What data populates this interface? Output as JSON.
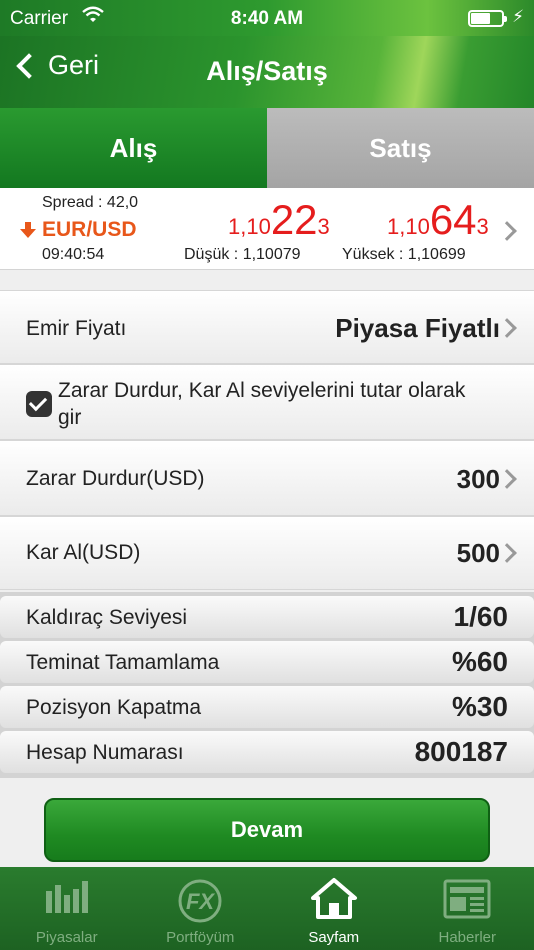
{
  "statusbar": {
    "carrier": "Carrier",
    "time": "8:40 AM"
  },
  "navbar": {
    "back_label": "Geri",
    "title": "Alış/Satış"
  },
  "segments": {
    "buy": "Alış",
    "sell": "Satış",
    "selected": "buy"
  },
  "quote": {
    "spread": "Spread : 42,0",
    "pair": "EUR/USD",
    "time": "09:40:54",
    "bid": {
      "prefix": "1,10",
      "big": "22",
      "suffix": "3"
    },
    "ask": {
      "prefix": "1,10",
      "big": "64",
      "suffix": "3"
    },
    "low": "Düşük :  1,10079",
    "high": "Yüksek : 1,10699"
  },
  "order": {
    "price_label": "Emir Fiyatı",
    "price_value": "Piyasa Fiyatlı",
    "checkbox_text": "Zarar Durdur, Kar Al seviyelerini tutar olarak gir",
    "checkbox_checked": true,
    "stop_label": "Zarar Durdur(USD)",
    "stop_value": "300",
    "take_label": "Kar Al(USD)",
    "take_value": "500"
  },
  "info": [
    {
      "label": "Kaldıraç Seviyesi",
      "value": "1/60"
    },
    {
      "label": "Teminat Tamamlama",
      "value": "%60"
    },
    {
      "label": "Pozisyon Kapatma",
      "value": "%30"
    },
    {
      "label": "Hesap Numarası",
      "value": "800187"
    }
  ],
  "continue_label": "Devam",
  "tabs": [
    {
      "label": "Piyasalar",
      "icon": "chart-icon"
    },
    {
      "label": "Portföyüm",
      "icon": "fx-icon"
    },
    {
      "label": "Sayfam",
      "icon": "home-icon",
      "active": true
    },
    {
      "label": "Haberler",
      "icon": "news-icon"
    }
  ],
  "colors": {
    "brand_green": "#1f8a22",
    "price_red": "#e51d1d",
    "pair_orange": "#e8571a"
  }
}
